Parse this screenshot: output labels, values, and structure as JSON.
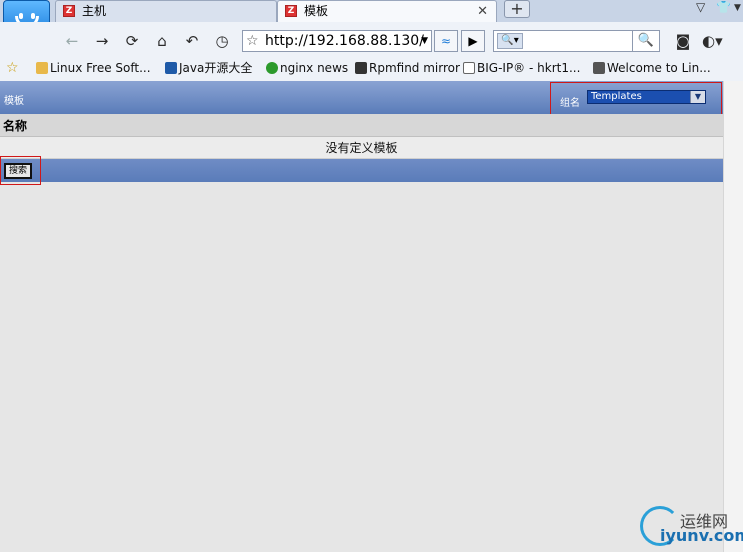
{
  "browser": {
    "tabs": [
      {
        "label": "主机",
        "active": false
      },
      {
        "label": "模板",
        "active": true
      }
    ],
    "new_tab_label": "+",
    "url": "http://192.168.88.130/",
    "bookmarks": [
      {
        "label": "Linux Free Soft...",
        "icon": "box-icon"
      },
      {
        "label": "Java开源大全",
        "icon": "open-icon"
      },
      {
        "label": "nginx news",
        "icon": "g-icon"
      },
      {
        "label": "Rpmfind mirror",
        "icon": "penguin-icon"
      },
      {
        "label": "BIG-IP® - hkrt1...",
        "icon": "page-icon"
      },
      {
        "label": "Welcome to Lin...",
        "icon": "figures-icon"
      }
    ]
  },
  "page": {
    "header_title": "模板",
    "group_label": "组名",
    "group_select_value": "Templates",
    "table_header_name": "名称",
    "empty_message": "没有定义模板",
    "search_button_label": "搜索"
  },
  "watermark": {
    "text_cn": "运维网",
    "text_domain": "iyunv.com"
  },
  "colors": {
    "header_blue": "#5a7cb9",
    "highlight_red": "#d01818",
    "select_blue": "#1b4fb0"
  }
}
